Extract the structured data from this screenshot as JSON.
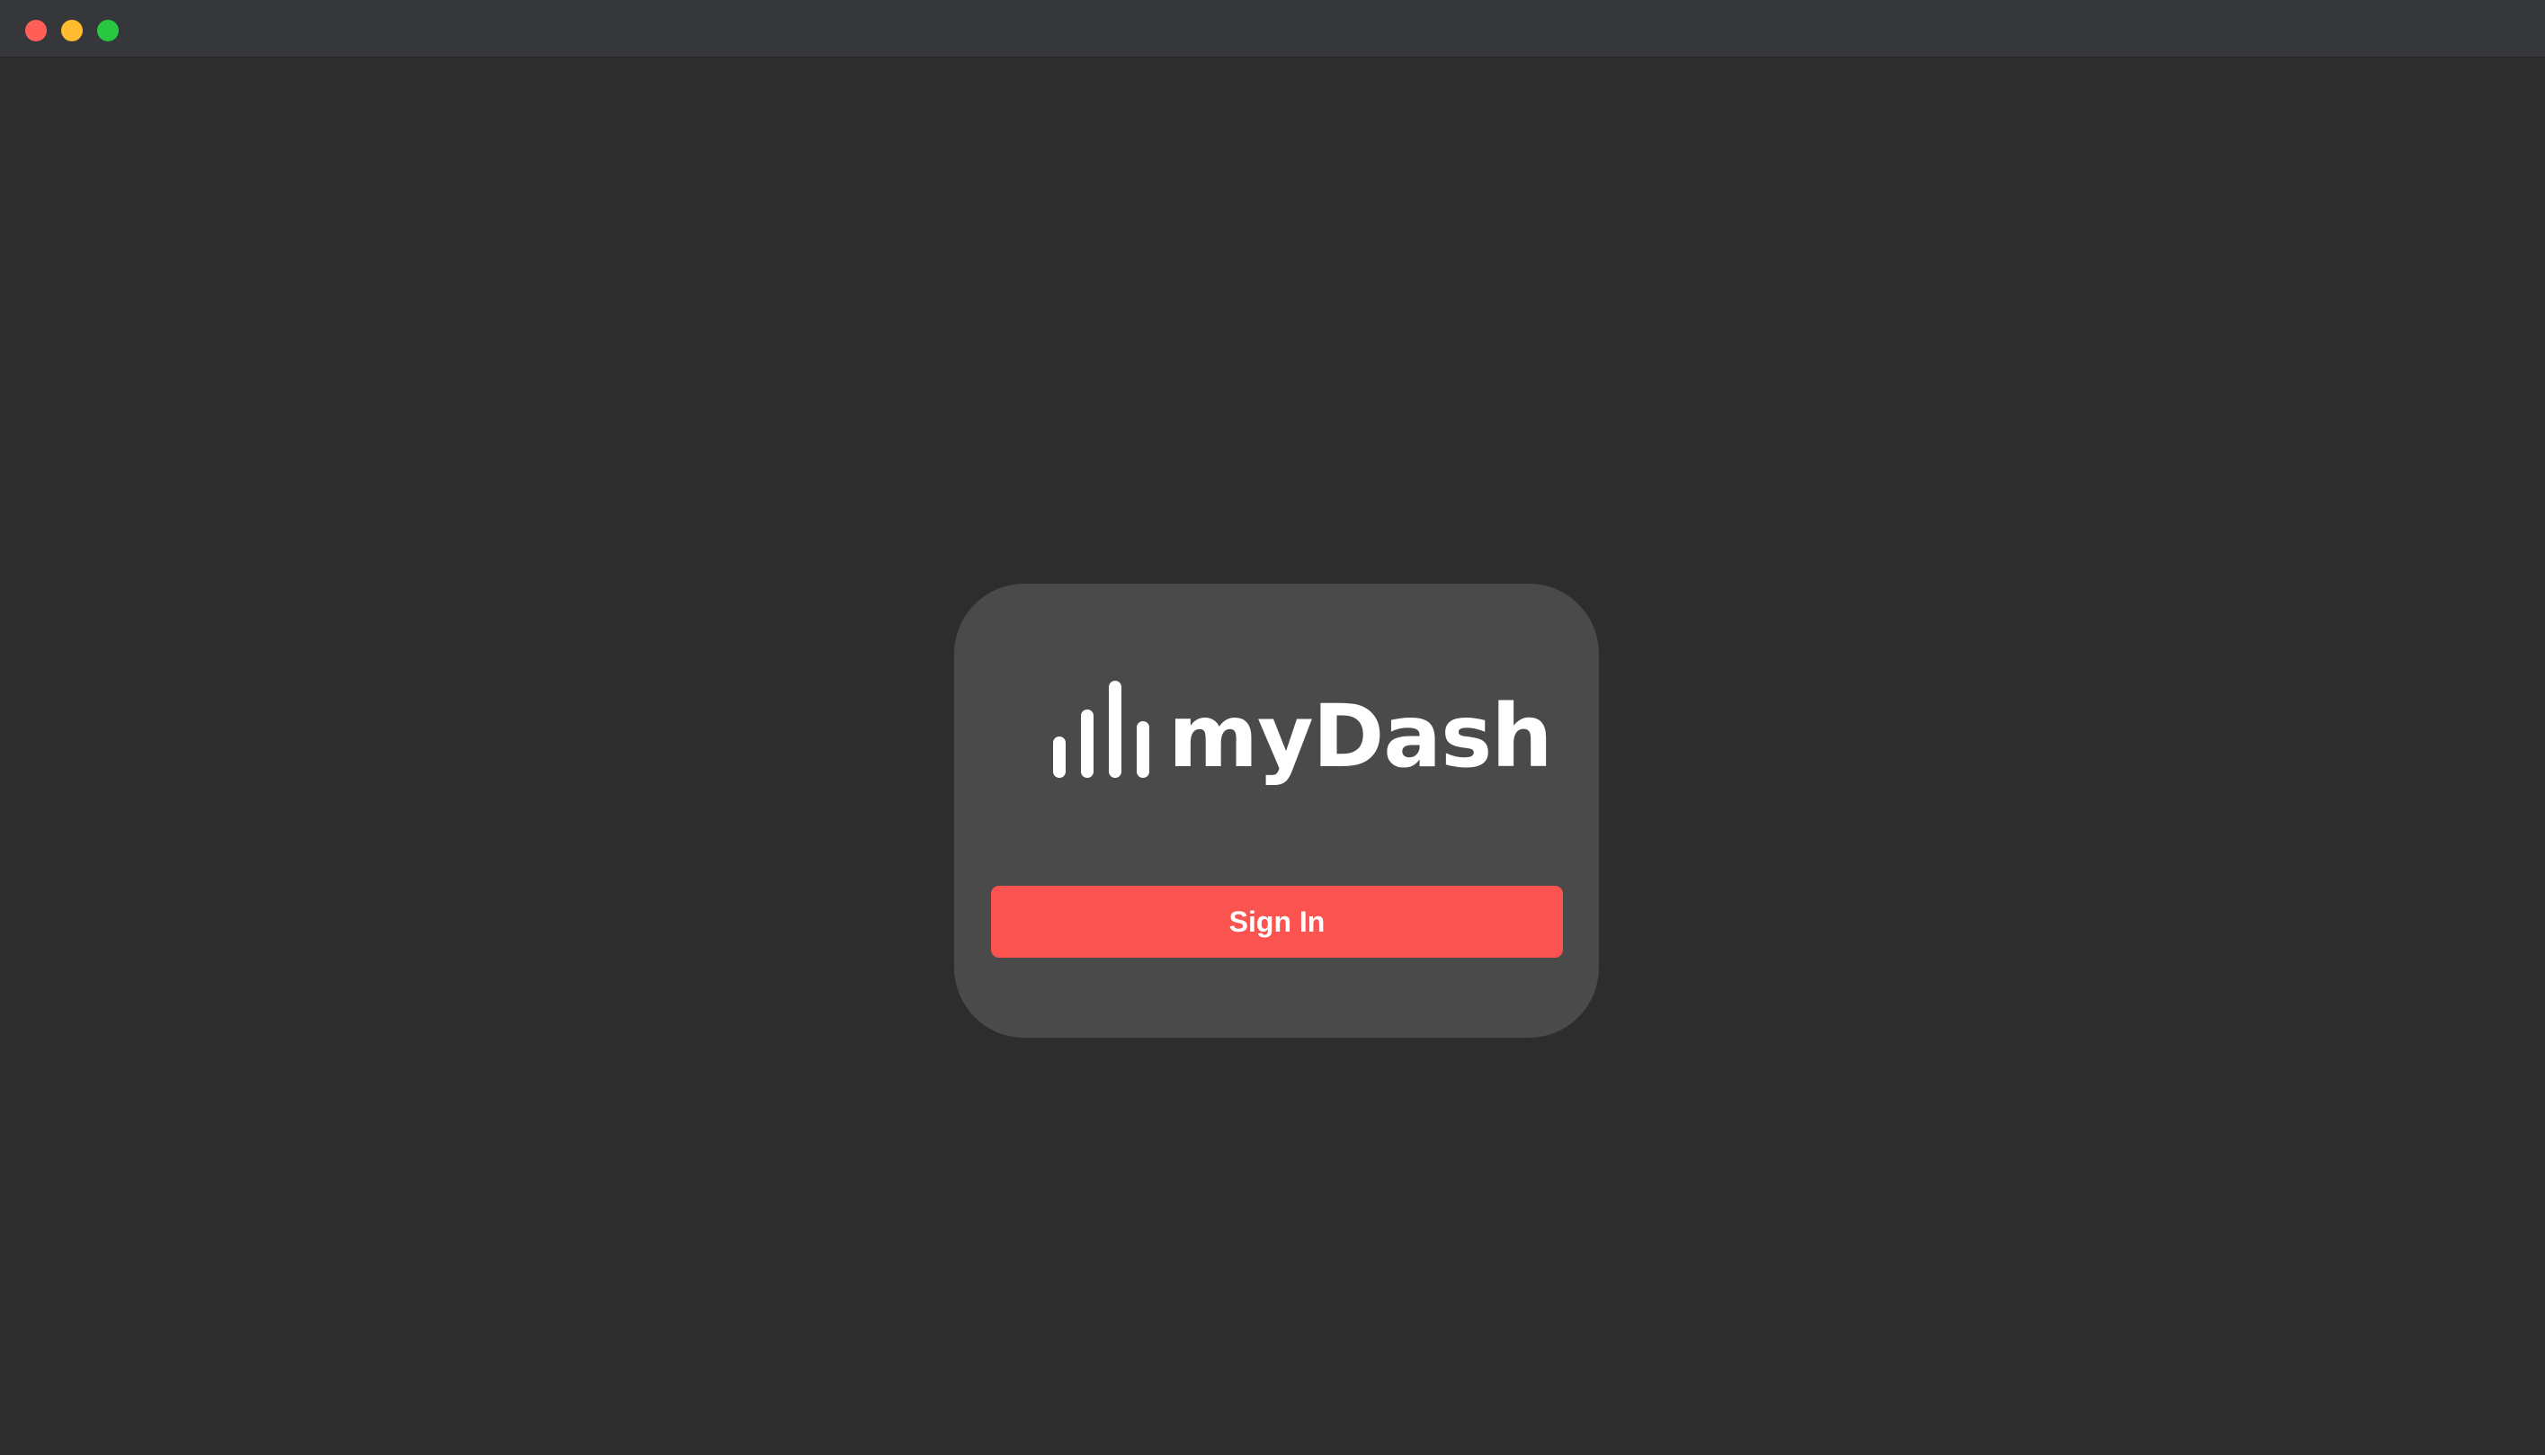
{
  "window": {
    "controls": {
      "close_icon": "close-icon",
      "minimize_icon": "minimize-icon",
      "zoom_icon": "zoom-icon"
    }
  },
  "login": {
    "logo_icon": "bar-chart-icon",
    "brand_name": "myDash",
    "signin_label": "Sign In"
  },
  "colors": {
    "background": "#2d2d2d",
    "titlebar": "#36373a",
    "card": "#4a4a4a",
    "accent": "#fb5450",
    "text": "#ffffff",
    "close": "#ff5f57",
    "minimize": "#febc2e",
    "zoom": "#28c840"
  }
}
